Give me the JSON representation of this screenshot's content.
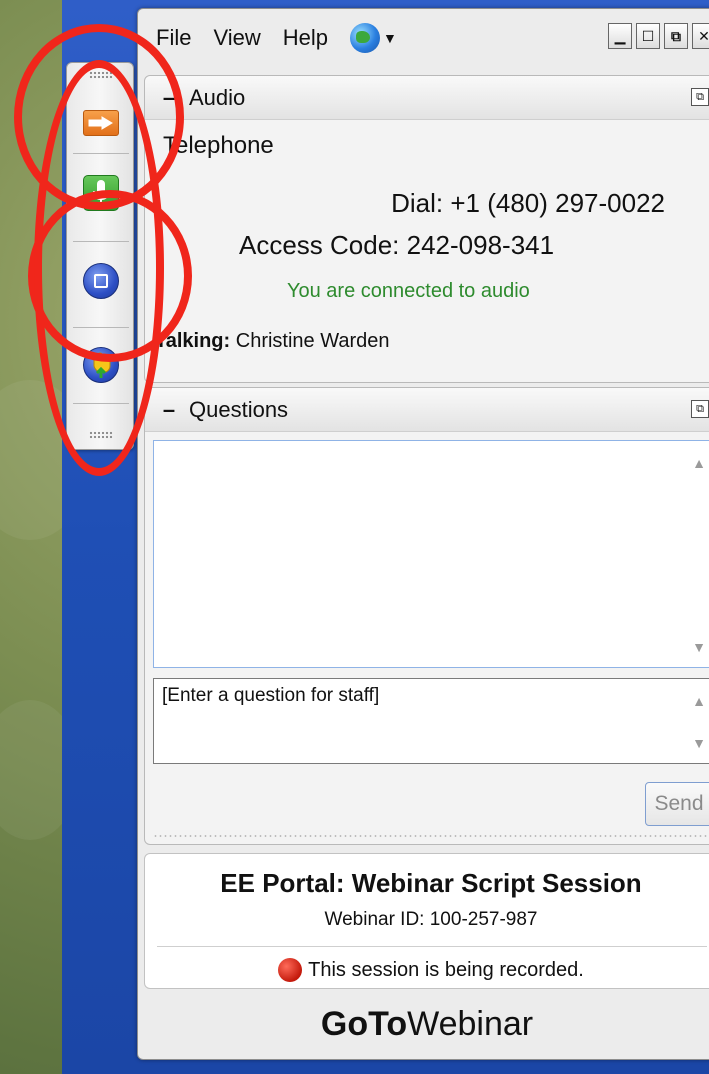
{
  "menu": {
    "items": [
      "File",
      "View",
      "Help"
    ],
    "language_icon": "globe-icon"
  },
  "window_controls": [
    "minimize",
    "maximize",
    "restore",
    "close"
  ],
  "audio": {
    "header": "Audio",
    "mode": "Telephone",
    "dial": "Dial: +1 (480) 297-0022",
    "access_code": "Access Code: 242-098-341",
    "status": "You are connected to audio",
    "talking_label": "Talking:",
    "talking_name": "Christine Warden"
  },
  "questions": {
    "header": "Questions",
    "input_placeholder": "[Enter a question for staff]",
    "send_label": "Send"
  },
  "session": {
    "title": "EE Portal: Webinar Script Session",
    "webinar_id": "Webinar ID: 100-257-987",
    "recording_notice": "This session is being recorded."
  },
  "brand": {
    "bold_part": "GoTo",
    "regular_part": "Webinar"
  },
  "colors": {
    "connected_text": "#2e8b2e",
    "annotation_red": "#f0261b",
    "desktop_blue": "#2350b8"
  }
}
